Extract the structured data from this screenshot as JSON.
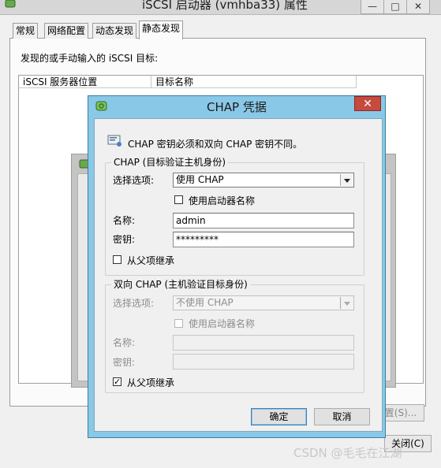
{
  "main_window": {
    "title": "iSCSI 启动器 (vmhba33) 属性",
    "tabs": [
      {
        "label": "常规"
      },
      {
        "label": "网络配置"
      },
      {
        "label": "动态发现"
      },
      {
        "label": "静态发现"
      }
    ],
    "discover_label": "发现的或手动输入的 iSCSI 目标:",
    "columns": [
      "iSCSI 服务器位置",
      "目标名称"
    ],
    "settings_button": "设置(S)...",
    "close_button": "关闭(C)"
  },
  "chap_dialog": {
    "title": "CHAP 凭据",
    "info_text": "CHAP 密钥必须和双向 CHAP 密钥不同。",
    "chap_group": {
      "legend": "CHAP (目标验证主机身份)",
      "select_label": "选择选项:",
      "select_value": "使用 CHAP",
      "use_initiator_name": "使用启动器名称",
      "use_initiator_name_checked": false,
      "name_label": "名称:",
      "name_value": "admin",
      "secret_label": "密钥:",
      "secret_value": "*********",
      "inherit_label": "从父项继承",
      "inherit_checked": false
    },
    "mutual_group": {
      "legend": "双向 CHAP (主机验证目标身份)",
      "select_label": "选择选项:",
      "select_value": "不使用 CHAP",
      "use_initiator_name": "使用启动器名称",
      "name_label": "名称:",
      "secret_label": "密钥:",
      "inherit_label": "从父项继承",
      "inherit_checked": true
    },
    "ok_button": "确定",
    "cancel_button": "取消"
  },
  "watermark": "CSDN @毛毛在江湖",
  "colors": {
    "dialog_frame": "#8ac8e8",
    "close_red": "#c84a3e",
    "disabled_text": "#8c8c8c"
  }
}
